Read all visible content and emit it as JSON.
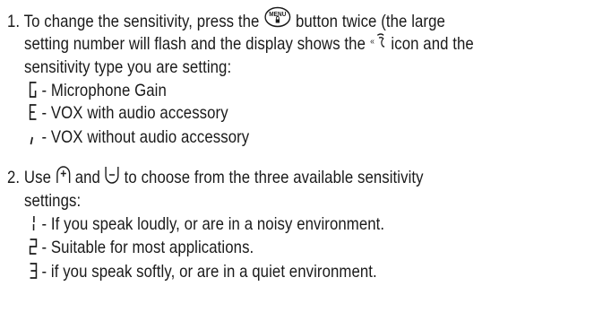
{
  "step1": {
    "number": "1.",
    "line1_a": "To change the sensitivity, press the",
    "menu_icon_text": "MENU",
    "line1_b": "button twice (the large",
    "line2_a": "setting number will flash and the display shows the",
    "line2_b": "icon and the",
    "line3": "sensitivity type you are setting:",
    "types": [
      {
        "symbol": "G",
        "label": "- Microphone Gain"
      },
      {
        "symbol": "E",
        "label": "- VOX with audio accessory"
      },
      {
        "symbol": "i",
        "label": "-  VOX without audio accessory"
      }
    ]
  },
  "step2": {
    "number": "2.",
    "line1_a": "Use",
    "line1_b": "and",
    "line1_c": "to choose from the three available sensitivity",
    "line2": "settings:",
    "settings": [
      {
        "symbol": "1",
        "label": "- If you speak loudly, or are in a noisy environment."
      },
      {
        "symbol": "2",
        "label": "- Suitable for most applications."
      },
      {
        "symbol": "3",
        "label": "- if you speak softly, or are in a quiet environment."
      }
    ]
  }
}
